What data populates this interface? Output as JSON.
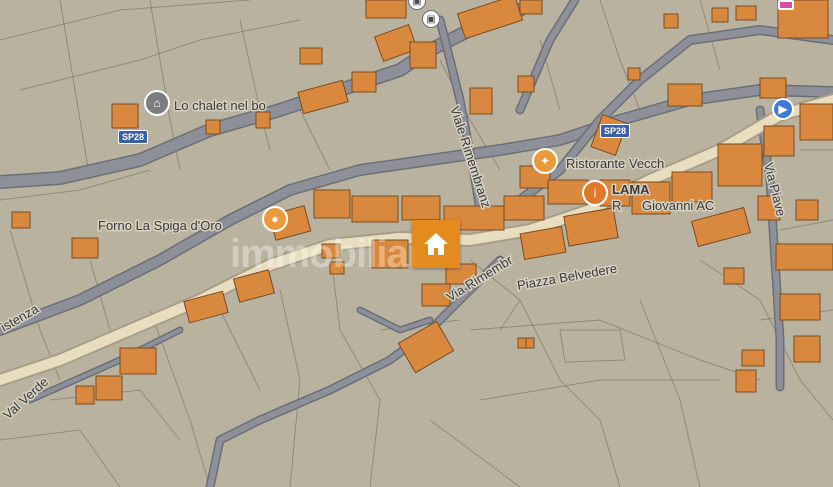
{
  "map": {
    "labels": {
      "lo_chalet": "Lo chalet nel bo",
      "forno": "Forno La Spiga d'Oro",
      "ristorante": "Ristorante Vecch",
      "lama": "LAMA",
      "ra": "R",
      "giovanni": "Giovanni AC",
      "viale_rimembranze": "Viale Rimembranz",
      "via_rimembranze": "Via Rimembr",
      "piazza_belvedere": "Piazza Belvedere",
      "via_piave": "Via Piave",
      "val_verde": "Val Verde",
      "istenza": "istenza",
      "sp28_a": "SP28",
      "sp28_b": "SP28"
    },
    "watermark": "immobiliare",
    "colors": {
      "background": "#b9b29f",
      "building": "#d8893d",
      "road": "#8d9099",
      "main_road": "#e9ddbf",
      "marker": "#e58a1e",
      "shield": "#3b5ea8"
    },
    "icons": {
      "center": "home-icon",
      "chalet_pin": "lodging-icon",
      "forno_pin": "bakery-icon",
      "restaurant_pin": "restaurant-icon",
      "lama_pin": "shop-icon",
      "bus": "bus-icon"
    }
  }
}
